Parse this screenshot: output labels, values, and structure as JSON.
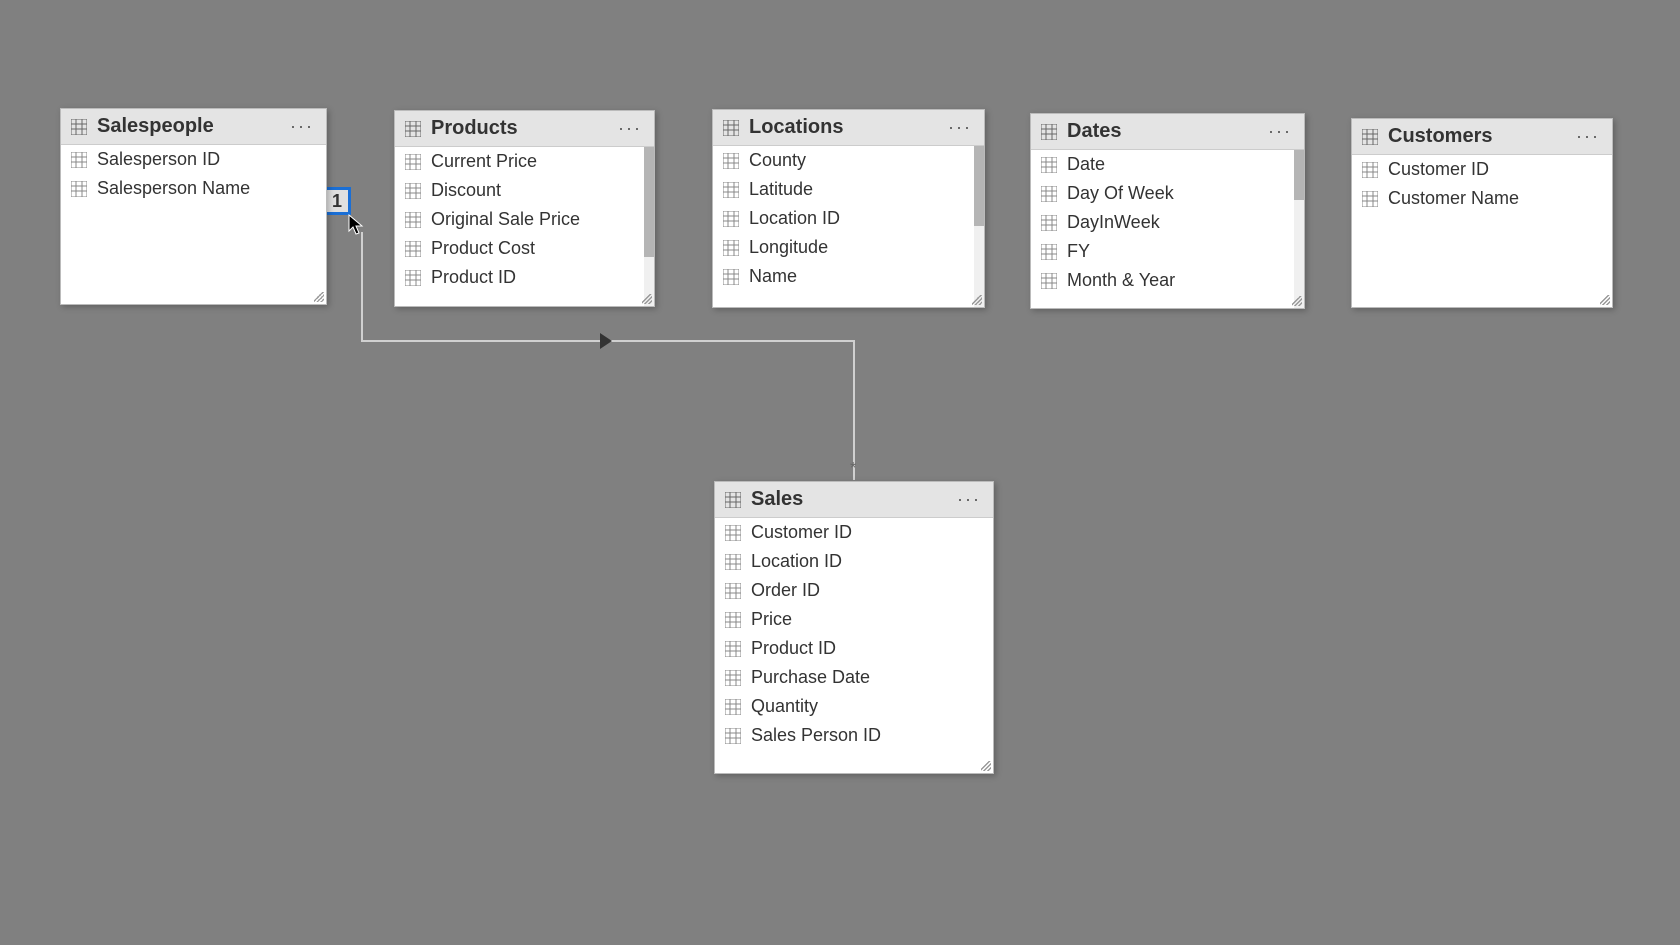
{
  "tables": {
    "salespeople": {
      "title": "Salespeople",
      "fields": [
        "Salesperson ID",
        "Salesperson Name"
      ]
    },
    "products": {
      "title": "Products",
      "fields": [
        "Current Price",
        "Discount",
        "Original Sale Price",
        "Product Cost",
        "Product ID"
      ]
    },
    "locations": {
      "title": "Locations",
      "fields": [
        "County",
        "Latitude",
        "Location ID",
        "Longitude",
        "Name"
      ]
    },
    "dates": {
      "title": "Dates",
      "fields": [
        "Date",
        "Day Of Week",
        "DayInWeek",
        "FY",
        "Month & Year"
      ]
    },
    "customers": {
      "title": "Customers",
      "fields": [
        "Customer ID",
        "Customer Name"
      ]
    },
    "sales": {
      "title": "Sales",
      "fields": [
        "Customer ID",
        "Location ID",
        "Order ID",
        "Price",
        "Product ID",
        "Purchase Date",
        "Quantity",
        "Sales Person ID"
      ]
    }
  },
  "relationship": {
    "from_label": "1",
    "to_label": "*"
  },
  "menu_glyph": "···"
}
